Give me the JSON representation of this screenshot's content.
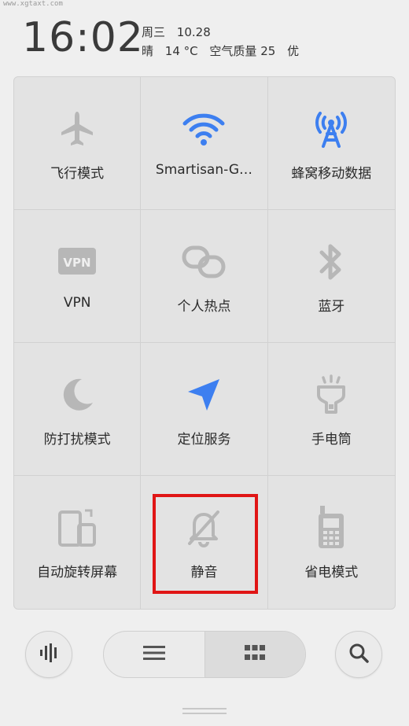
{
  "watermark": "www.xgtaxt.com",
  "status": {
    "time": "16:02",
    "weekday": "周三",
    "date": "10.28",
    "weather": "晴",
    "temperature": "14 °C",
    "air_quality": "空气质量 25",
    "air_quality_level": "优"
  },
  "tiles": [
    {
      "label": "飞行模式",
      "icon": "airplane-icon",
      "active": false
    },
    {
      "label": "Smartisan-G…",
      "icon": "wifi-icon",
      "active": true
    },
    {
      "label": "蜂窝移动数据",
      "icon": "cellular-tower-icon",
      "active": true
    },
    {
      "label": "VPN",
      "icon": "vpn-icon",
      "active": false
    },
    {
      "label": "个人热点",
      "icon": "hotspot-icon",
      "active": false
    },
    {
      "label": "蓝牙",
      "icon": "bluetooth-icon",
      "active": false
    },
    {
      "label": "防打扰模式",
      "icon": "moon-icon",
      "active": false
    },
    {
      "label": "定位服务",
      "icon": "location-arrow-icon",
      "active": true
    },
    {
      "label": "手电筒",
      "icon": "flashlight-icon",
      "active": false
    },
    {
      "label": "自动旋转屏幕",
      "icon": "auto-rotate-icon",
      "active": false
    },
    {
      "label": "静音",
      "icon": "bell-mute-icon",
      "active": false
    },
    {
      "label": "省电模式",
      "icon": "battery-saver-icon",
      "active": false
    }
  ],
  "colors": {
    "active": "#3d7ff0",
    "inactive": "#b7b7b7",
    "highlight": "#e01515"
  },
  "bottom_bar": {
    "left_icon": "voice-wave-icon",
    "segment_left_icon": "list-menu-icon",
    "segment_right_icon": "grid-icon",
    "right_icon": "search-icon"
  }
}
